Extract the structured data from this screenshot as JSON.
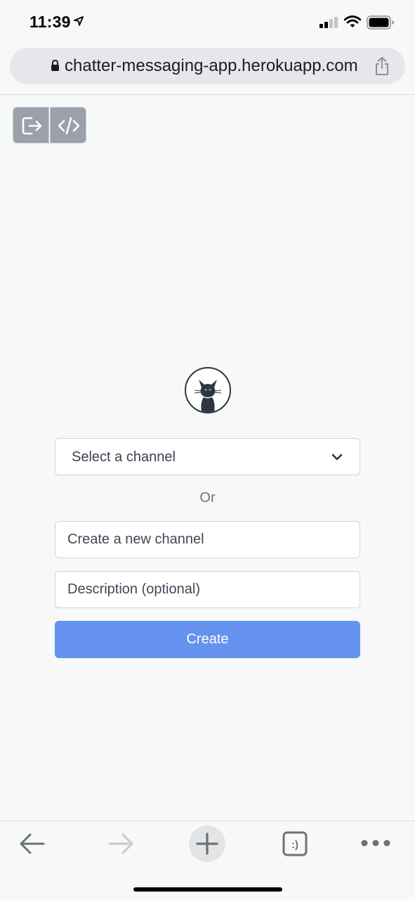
{
  "status_bar": {
    "time": "11:39",
    "icons": [
      "location-arrow-icon",
      "cellular-signal-icon",
      "wifi-icon",
      "battery-icon"
    ]
  },
  "browser": {
    "url": "chatter-messaging-app.herokuapp.com",
    "icons": [
      "lock-icon",
      "share-icon"
    ]
  },
  "toolbar": {
    "logout_icon": "logout-icon",
    "code_icon": "code-icon",
    "button_color": "#9aa1a9"
  },
  "avatar": {
    "icon": "cat-icon"
  },
  "form": {
    "select_label": "Select a channel",
    "or_text": "Or",
    "channel_name_placeholder": "Create a new channel",
    "channel_name_value": "",
    "description_placeholder": "Description (optional)",
    "description_value": "",
    "create_label": "Create",
    "accent_color": "#6592ee"
  },
  "bottom_bar": {
    "icons": [
      "back-arrow-icon",
      "forward-arrow-icon",
      "plus-icon",
      "tabs-icon",
      "more-icon"
    ],
    "tabs_badge": ":)"
  }
}
